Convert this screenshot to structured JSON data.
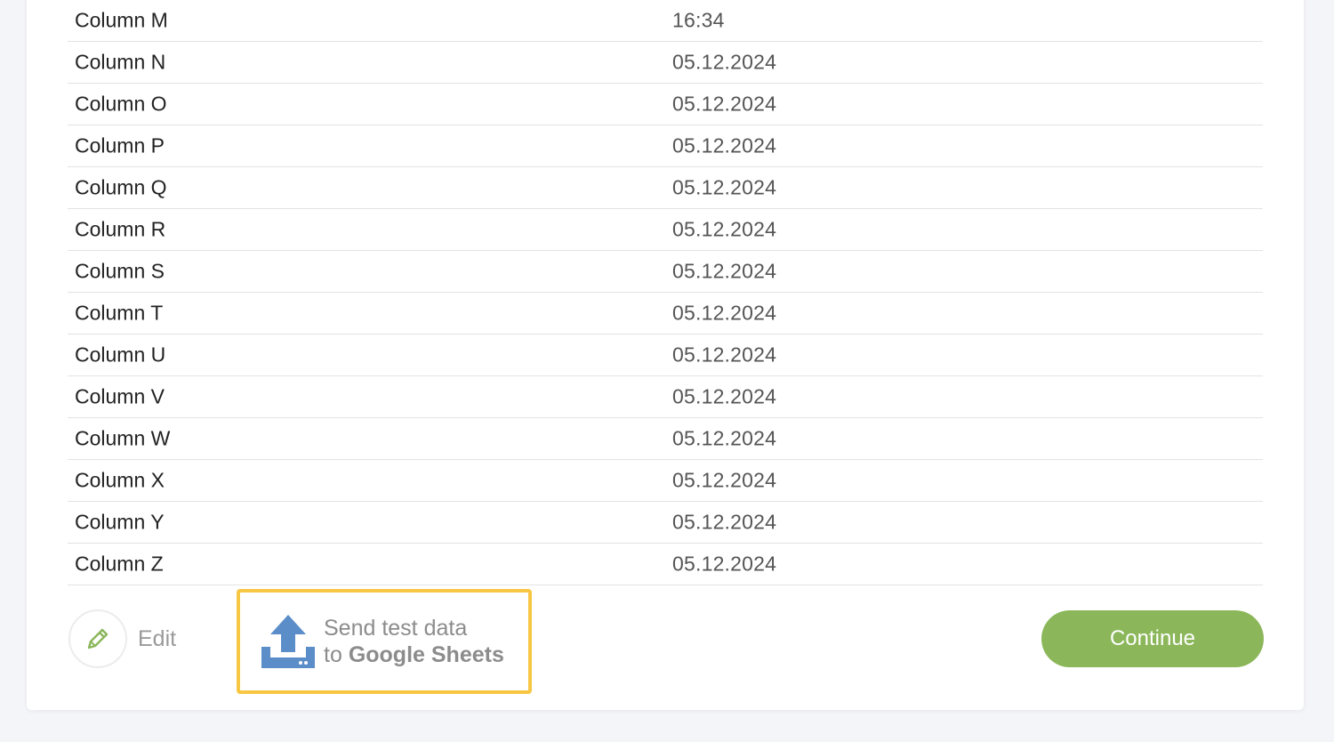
{
  "rows": [
    {
      "name": "Column M",
      "value": "16:34"
    },
    {
      "name": "Column N",
      "value": "05.12.2024"
    },
    {
      "name": "Column O",
      "value": "05.12.2024"
    },
    {
      "name": "Column P",
      "value": "05.12.2024"
    },
    {
      "name": "Column Q",
      "value": "05.12.2024"
    },
    {
      "name": "Column R",
      "value": "05.12.2024"
    },
    {
      "name": "Column S",
      "value": "05.12.2024"
    },
    {
      "name": "Column T",
      "value": "05.12.2024"
    },
    {
      "name": "Column U",
      "value": "05.12.2024"
    },
    {
      "name": "Column V",
      "value": "05.12.2024"
    },
    {
      "name": "Column W",
      "value": "05.12.2024"
    },
    {
      "name": "Column X",
      "value": "05.12.2024"
    },
    {
      "name": "Column Y",
      "value": "05.12.2024"
    },
    {
      "name": "Column Z",
      "value": "05.12.2024"
    }
  ],
  "actions": {
    "edit_label": "Edit",
    "edit_icon": "pencil-icon",
    "send_line1": "Send test data",
    "send_line2_prefix": "to",
    "send_line2_service": "Google Sheets",
    "send_icon": "upload-icon",
    "continue_label": "Continue"
  },
  "colors": {
    "accent_green": "#8bb75a",
    "highlight_yellow": "#f7c744",
    "upload_blue": "#5b8ec9"
  }
}
